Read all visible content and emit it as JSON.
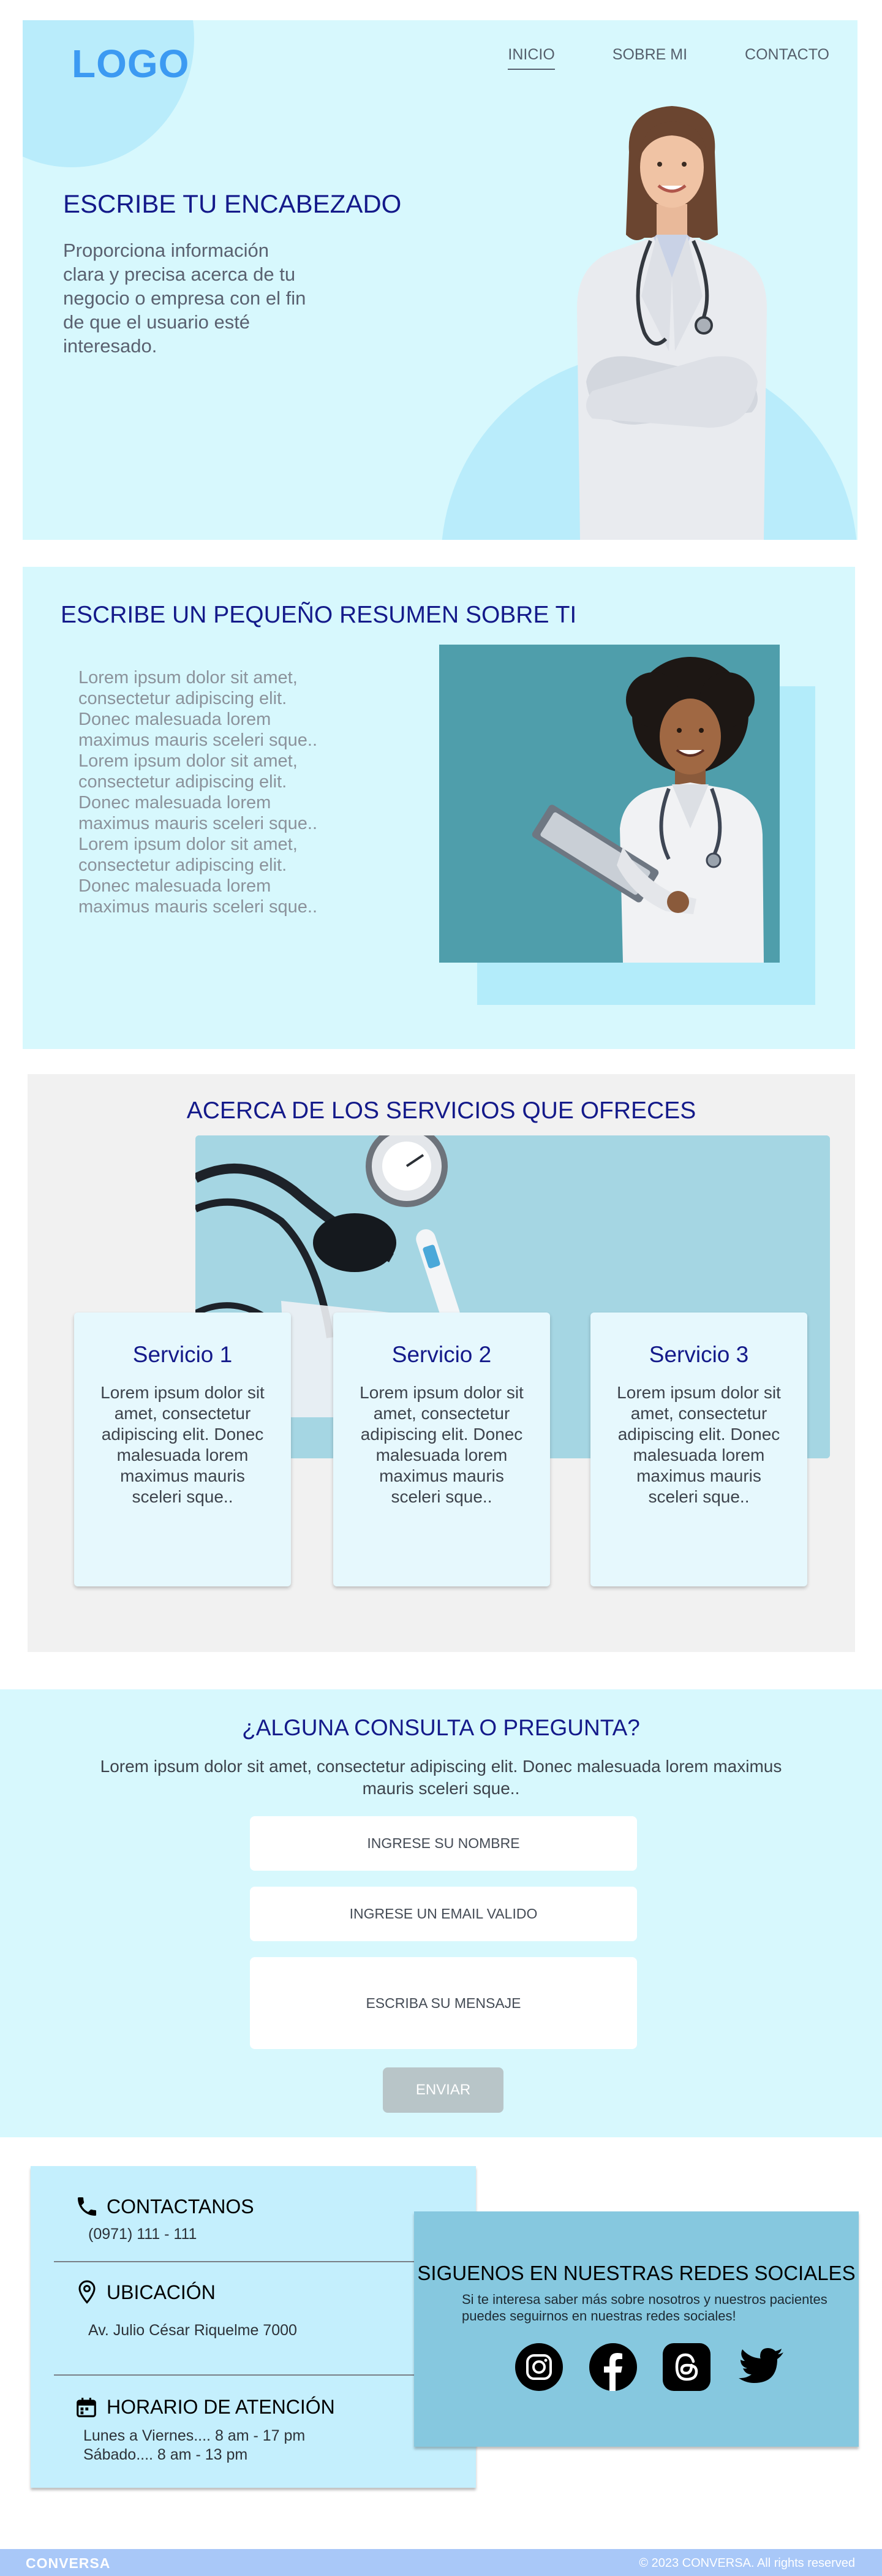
{
  "header": {
    "logo": "LOGO",
    "nav": [
      {
        "label": "INICIO",
        "active": true
      },
      {
        "label": "SOBRE MI",
        "active": false
      },
      {
        "label": "CONTACTO",
        "active": false
      }
    ]
  },
  "hero": {
    "title": "ESCRIBE TU ENCABEZADO",
    "text": "Proporciona información clara y precisa acerca de tu negocio o empresa con el fin de que el usuario esté interesado."
  },
  "about": {
    "title": "ESCRIBE UN PEQUEÑO RESUMEN SOBRE TI",
    "text": "Lorem ipsum dolor sit amet, consectetur adipiscing elit. Donec malesuada lorem maximus mauris sceleri sque.. Lorem ipsum dolor sit amet, consectetur adipiscing elit. Donec malesuada lorem maximus mauris sceleri sque.. Lorem ipsum dolor sit amet, consectetur adipiscing elit. Donec malesuada lorem maximus mauris sceleri sque.."
  },
  "services": {
    "title": "ACERCA DE LOS SERVICIOS QUE OFRECES",
    "items": [
      {
        "title": "Servicio 1",
        "text": "Lorem ipsum dolor sit amet, consectetur adipiscing elit. Donec malesuada lorem maximus mauris sceleri sque.."
      },
      {
        "title": "Servicio 2",
        "text": "Lorem ipsum dolor sit amet, consectetur adipiscing elit. Donec malesuada lorem maximus mauris sceleri sque.."
      },
      {
        "title": "Servicio 3",
        "text": "Lorem ipsum dolor sit amet, consectetur adipiscing elit. Donec malesuada lorem maximus mauris sceleri sque.."
      }
    ]
  },
  "contact_form": {
    "title": "¿ALGUNA CONSULTA O PREGUNTA?",
    "text": "Lorem ipsum dolor sit amet, consectetur adipiscing elit. Donec malesuada lorem maximus mauris sceleri sque..",
    "name_placeholder": "INGRESE SU NOMBRE",
    "email_placeholder": "INGRESE UN EMAIL VALIDO",
    "message_placeholder": "ESCRIBA SU MENSAJE",
    "submit_label": "ENVIAR"
  },
  "info": {
    "contact_title": "CONTACTANOS",
    "phone": "(0971) 111 - 111",
    "location_title": "UBICACIÓN",
    "address": "Av. Julio César Riquelme 7000",
    "hours_title": "HORARIO DE ATENCIÓN",
    "hours_weekdays": "Lunes a Viernes.... 8 am - 17 pm",
    "hours_saturday": "Sábado.... 8 am - 13 pm"
  },
  "social": {
    "title": "SIGUENOS EN NUESTRAS REDES SOCIALES",
    "text": "Si te interesa saber más sobre nosotros y nuestros pacientes puedes seguirnos en nuestras redes sociales!",
    "icons": [
      "instagram-icon",
      "facebook-icon",
      "threads-icon",
      "twitter-icon"
    ]
  },
  "footer": {
    "brand": "CONVERSA",
    "copyright": "© 2023 CONVERSA. All rights reserved"
  },
  "colors": {
    "accent": "#3c9af2",
    "heading": "#141a8a",
    "hero_bg": "#d7f8fd",
    "bottom_bar": "#a9c8f8"
  }
}
